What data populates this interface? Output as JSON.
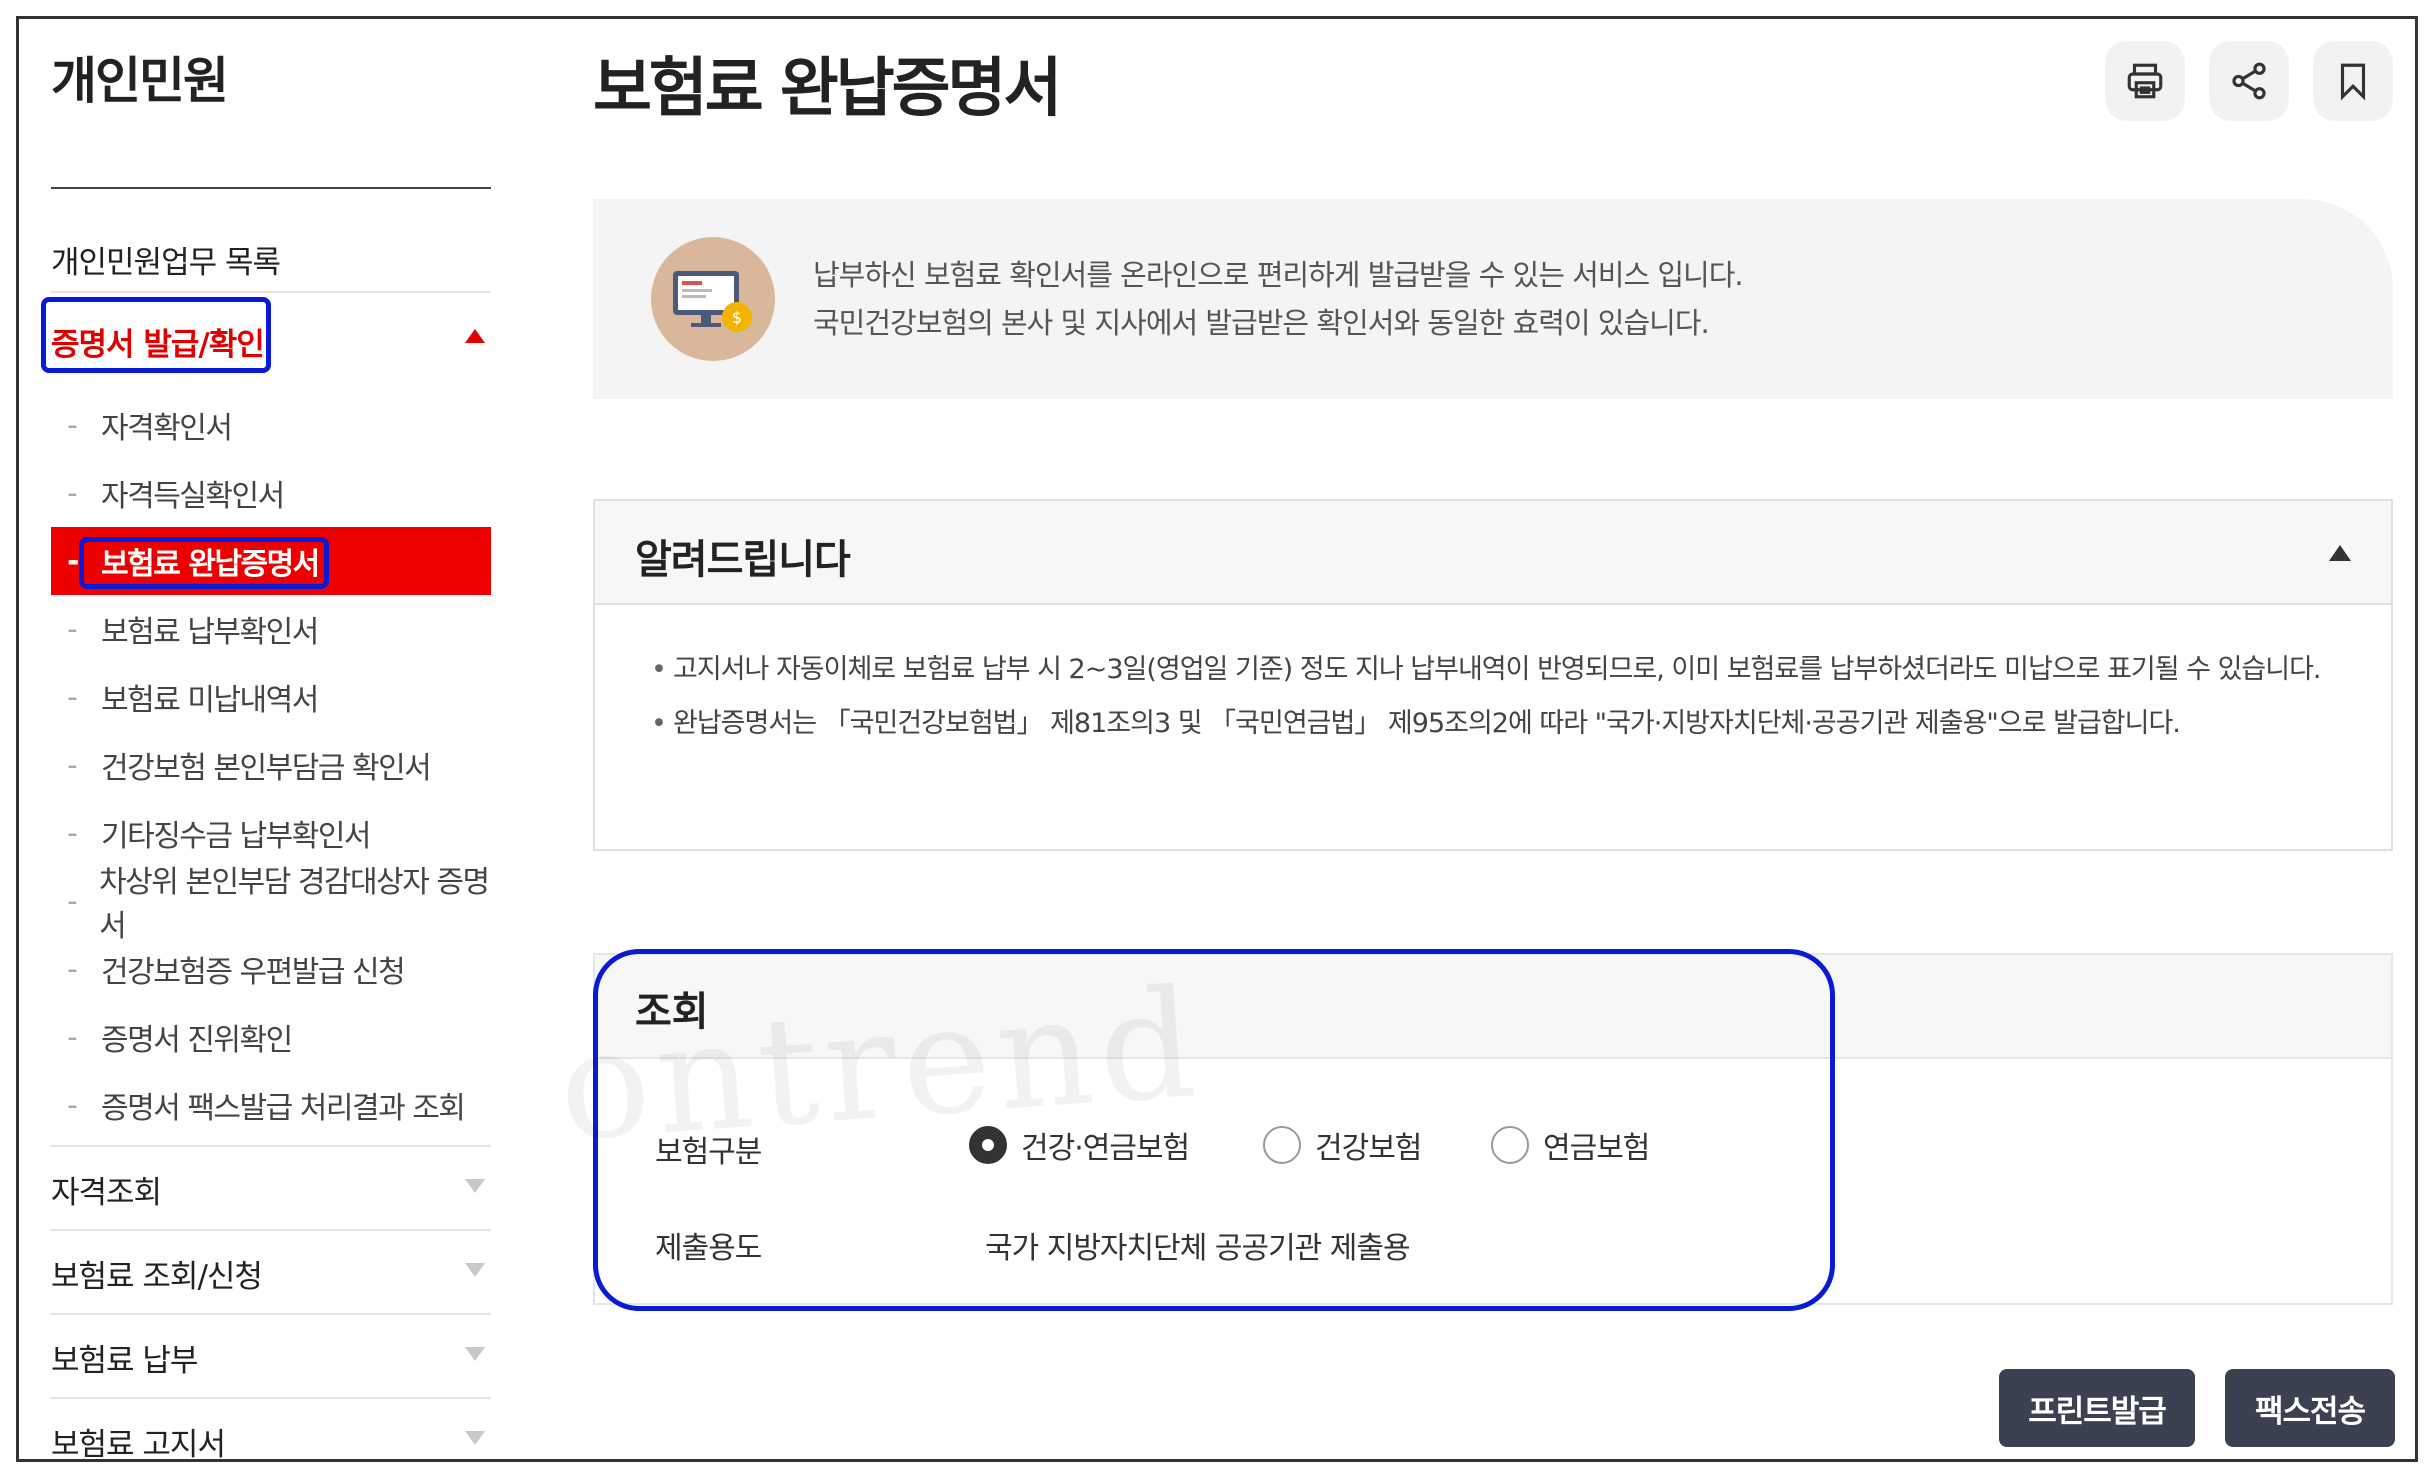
{
  "sidebar": {
    "title": "개인민원",
    "list_head": "개인민원업무 목록",
    "active_category": "증명서 발급/확인",
    "sub_items": [
      "자격확인서",
      "자격득실확인서",
      "보험료 완납증명서",
      "보험료 납부확인서",
      "보험료 미납내역서",
      "건강보험 본인부담금 확인서",
      "기타징수금 납부확인서",
      "차상위 본인부담 경감대상자 증명서",
      "건강보험증 우편발급 신청",
      "증명서 진위확인",
      "증명서 팩스발급 처리결과 조회"
    ],
    "current_sub_index": 2,
    "categories": [
      "자격조회",
      "보험료 조회/신청",
      "보험료 납부",
      "보험료 고지서"
    ]
  },
  "main": {
    "title": "보험료 완납증명서",
    "toolbar": {
      "print": "printer-icon",
      "share": "share-icon",
      "bookmark": "bookmark-icon"
    },
    "intro": {
      "line1": "납부하신 보험료 확인서를 온라인으로 편리하게 발급받을 수 있는 서비스 입니다.",
      "line2": "국민건강보험의 본사 및 지사에서 발급받은 확인서와 동일한 효력이 있습니다."
    },
    "notice": {
      "title": "알려드립니다",
      "items": [
        "고지서나 자동이체로 보험료 납부 시 2~3일(영업일 기준) 정도 지나 납부내역이 반영되므로, 이미 보험료를 납부하셨더라도 미납으로 표기될 수 있습니다.",
        "완납증명서는 「국민건강보험법」 제81조의3 및 「국민연금법」 제95조의2에 따라 \"국가·지방자치단체·공공기관 제출용\"으로 발급합니다."
      ]
    },
    "query": {
      "title": "조회",
      "insurance_label": "보험구분",
      "options": [
        "건강·연금보험",
        "건강보험",
        "연금보험"
      ],
      "selected_option_index": 0,
      "purpose_label": "제출용도",
      "purpose_value": "국가 지방자치단체 공공기관 제출용"
    },
    "actions": {
      "print_issue": "프린트발급",
      "fax_send": "팩스전송"
    }
  },
  "watermark": "ontrend",
  "colors": {
    "active_red": "#ef0000",
    "highlight_blue": "#0a1ad6",
    "button_dark": "#3b4150",
    "panel_gray": "#f4f4f4"
  }
}
